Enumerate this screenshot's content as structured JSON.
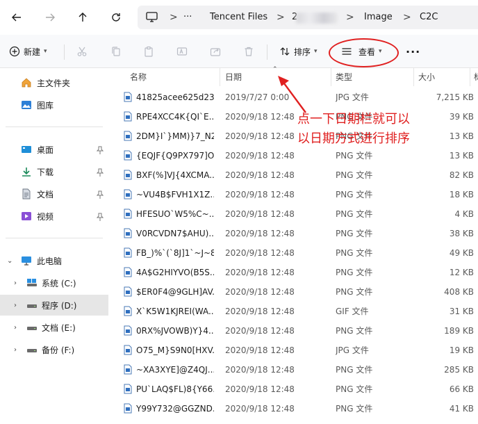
{
  "address_bar": {
    "crumbs": [
      "Tencent Files",
      "2",
      "Image",
      "C2C"
    ],
    "more": "···",
    "sep": ">"
  },
  "toolbar": {
    "new_label": "新建",
    "sort_label": "排序",
    "view_label": "查看",
    "more": "···"
  },
  "sidebar": {
    "quick": [
      {
        "label": "主文件夹",
        "icon": "home-icon"
      },
      {
        "label": "图库",
        "icon": "gallery-icon"
      }
    ],
    "pinned": [
      {
        "label": "桌面",
        "icon": "desktop-icon"
      },
      {
        "label": "下载",
        "icon": "download-icon"
      },
      {
        "label": "文档",
        "icon": "document-icon"
      },
      {
        "label": "视频",
        "icon": "video-icon"
      }
    ],
    "pc_label": "此电脑",
    "drives": [
      {
        "label": "系统 (C:)",
        "selected": false
      },
      {
        "label": "程序 (D:)",
        "selected": true
      },
      {
        "label": "文档 (E:)",
        "selected": false
      },
      {
        "label": "备份 (F:)",
        "selected": false
      }
    ]
  },
  "columns": {
    "name": "名称",
    "date": "日期",
    "type": "类型",
    "size": "大小",
    "extra": "标"
  },
  "files": [
    {
      "name": "41825acee625d23...",
      "date": "2019/7/27 0:00",
      "type": "JPG 文件",
      "size": "7,215 KB"
    },
    {
      "name": "RPE4XCC4K{QI`E...",
      "date": "2020/9/18 12:48",
      "type": "PNG 文件",
      "size": "39 KB"
    },
    {
      "name": "2DM}I`}MM)}7_N2...",
      "date": "2020/9/18 12:48",
      "type": "PNG 文件",
      "size": "13 KB"
    },
    {
      "name": "{EQJF{Q9PX797]O...",
      "date": "2020/9/18 12:48",
      "type": "PNG 文件",
      "size": "13 KB"
    },
    {
      "name": "BXF(%]VJ{4XCMA...",
      "date": "2020/9/18 12:48",
      "type": "PNG 文件",
      "size": "82 KB"
    },
    {
      "name": "~VU4B$FVH1X1Z...",
      "date": "2020/9/18 12:48",
      "type": "PNG 文件",
      "size": "18 KB"
    },
    {
      "name": "HFESUO`W5%C~...",
      "date": "2020/9/18 12:48",
      "type": "PNG 文件",
      "size": "4 KB"
    },
    {
      "name": "V0RCVDN7$AHU)...",
      "date": "2020/9/18 12:48",
      "type": "PNG 文件",
      "size": "38 KB"
    },
    {
      "name": "FB_)%`(`8J]1`~J~8...",
      "date": "2020/9/18 12:48",
      "type": "PNG 文件",
      "size": "49 KB"
    },
    {
      "name": "4A$G2HIYVO(B5S...",
      "date": "2020/9/18 12:48",
      "type": "PNG 文件",
      "size": "12 KB"
    },
    {
      "name": "$ER0F4@9GLH]AV...",
      "date": "2020/9/18 12:48",
      "type": "PNG 文件",
      "size": "408 KB"
    },
    {
      "name": "X`K5W1KJREI(WA...",
      "date": "2020/9/18 12:48",
      "type": "GIF 文件",
      "size": "31 KB"
    },
    {
      "name": "0RX%JVOWB)Y}4...",
      "date": "2020/9/18 12:48",
      "type": "PNG 文件",
      "size": "189 KB"
    },
    {
      "name": "O75_M}S9N0[HXV...",
      "date": "2020/9/18 12:48",
      "type": "JPG 文件",
      "size": "19 KB"
    },
    {
      "name": "~XA3XYE]@Z4QJ...",
      "date": "2020/9/18 12:48",
      "type": "PNG 文件",
      "size": "285 KB"
    },
    {
      "name": "PU`LAQ$FL)8{Y66...",
      "date": "2020/9/18 12:48",
      "type": "PNG 文件",
      "size": "66 KB"
    },
    {
      "name": "Y99Y732@GGZND...",
      "date": "2020/9/18 12:48",
      "type": "PNG 文件",
      "size": "41 KB"
    }
  ],
  "annotation": {
    "line1": "点一下日期栏就可以",
    "line2": "以日期方式进行排序",
    "color": "#e02020"
  }
}
